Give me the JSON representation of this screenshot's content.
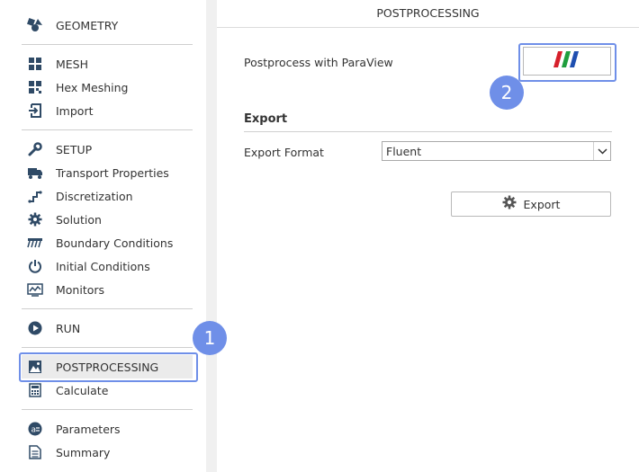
{
  "sidebar": {
    "items": [
      {
        "label": "GEOMETRY",
        "icon": "geometry-icon"
      },
      {
        "label": "MESH",
        "icon": "mesh-icon"
      },
      {
        "label": "Hex Meshing",
        "icon": "hex-meshing-icon"
      },
      {
        "label": "Import",
        "icon": "import-icon"
      },
      {
        "label": "SETUP",
        "icon": "wrench-icon"
      },
      {
        "label": "Transport Properties",
        "icon": "truck-icon"
      },
      {
        "label": "Discretization",
        "icon": "discretization-icon"
      },
      {
        "label": "Solution",
        "icon": "gear-icon"
      },
      {
        "label": "Boundary Conditions",
        "icon": "boundary-icon"
      },
      {
        "label": "Initial Conditions",
        "icon": "power-icon"
      },
      {
        "label": "Monitors",
        "icon": "monitor-icon"
      },
      {
        "label": "RUN",
        "icon": "play-icon"
      },
      {
        "label": "POSTPROCESSING",
        "icon": "image-icon"
      },
      {
        "label": "Calculate",
        "icon": "calculator-icon"
      },
      {
        "label": "Parameters",
        "icon": "parameters-icon"
      },
      {
        "label": "Summary",
        "icon": "document-icon"
      }
    ],
    "active": "POSTPROCESSING"
  },
  "badges": {
    "one": "1",
    "two": "2"
  },
  "panel": {
    "title": "POSTPROCESSING",
    "paraview_label": "Postprocess with ParaView",
    "export_section": "Export",
    "export_format_label": "Export Format",
    "export_format_value": "Fluent",
    "export_button": "Export"
  },
  "colors": {
    "icon": "#2f4a66",
    "highlight": "#6f8fe8",
    "paraview_red": "#d6202b",
    "paraview_green": "#1f9e3e",
    "paraview_blue": "#1f4fb0"
  }
}
